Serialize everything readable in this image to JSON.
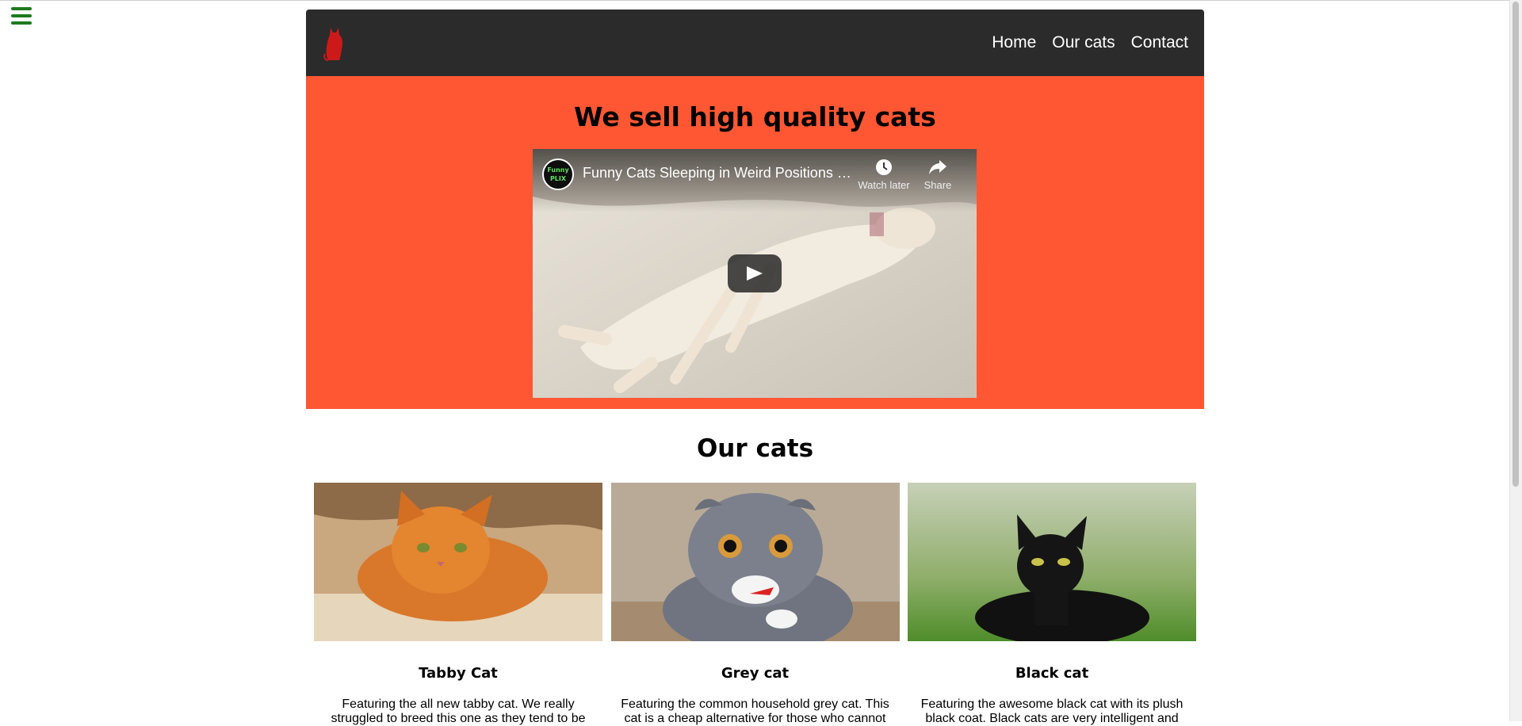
{
  "nav": {
    "links": [
      "Home",
      "Our cats",
      "Contact"
    ]
  },
  "hero": {
    "title": "We sell high quality cats",
    "video": {
      "title": "Funny Cats Sleeping in Weird Positions C...",
      "channel_logo_text": [
        "Funny",
        "PLIX"
      ],
      "actions": [
        "Watch later",
        "Share"
      ]
    }
  },
  "cats": {
    "title": "Our cats",
    "items": [
      {
        "name": "Tabby Cat",
        "description": "Featuring the all new tabby cat. We really struggled to breed this one as they tend to be"
      },
      {
        "name": "Grey cat",
        "description": "Featuring the common household grey cat. This cat is a cheap alternative for those who cannot"
      },
      {
        "name": "Black cat",
        "description": "Featuring the awesome black cat with its plush black coat. Black cats are very intelligent and"
      }
    ]
  },
  "colors": {
    "nav_bg": "#2b2b2b",
    "hero_bg": "#ff5733",
    "menu_icon": "#1e7a1e",
    "logo": "#cc1a1a"
  },
  "icons": [
    "hamburger-menu-icon",
    "cat-logo-icon",
    "clock-icon",
    "share-icon",
    "play-icon"
  ]
}
